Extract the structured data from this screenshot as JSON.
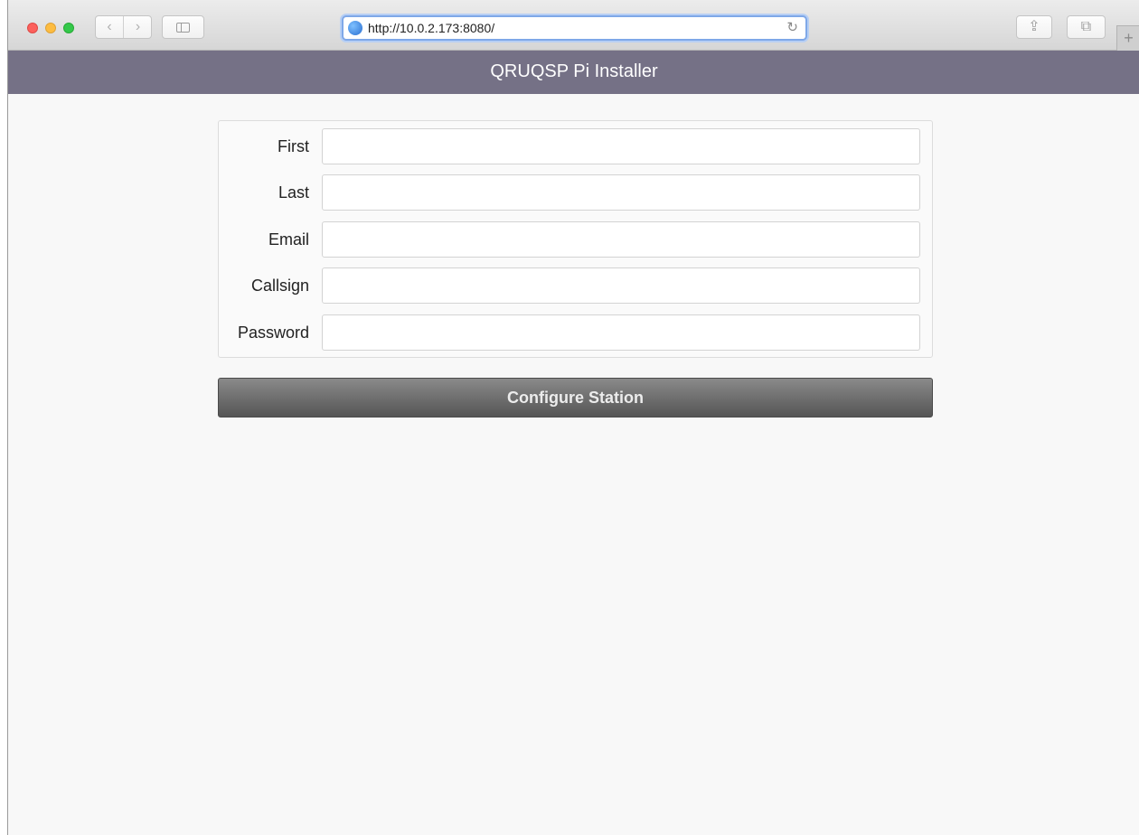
{
  "browser": {
    "url": "http://10.0.2.173:8080/",
    "back_glyph": "‹",
    "forward_glyph": "›",
    "reload_glyph": "↻",
    "share_glyph": "⇪",
    "tabs_glyph": "⧉",
    "new_tab_glyph": "+",
    "icons": [
      "sidebar-icon",
      "globe-icon",
      "reload-icon",
      "share-icon",
      "tabs-icon",
      "plus-icon"
    ]
  },
  "header": {
    "title": "QRUQSP Pi Installer",
    "background": "#757186"
  },
  "form": {
    "fields": [
      {
        "label": "First",
        "value": ""
      },
      {
        "label": "Last",
        "value": ""
      },
      {
        "label": "Email",
        "value": ""
      },
      {
        "label": "Callsign",
        "value": ""
      },
      {
        "label": "Password",
        "value": ""
      }
    ],
    "submit_label": "Configure Station"
  }
}
